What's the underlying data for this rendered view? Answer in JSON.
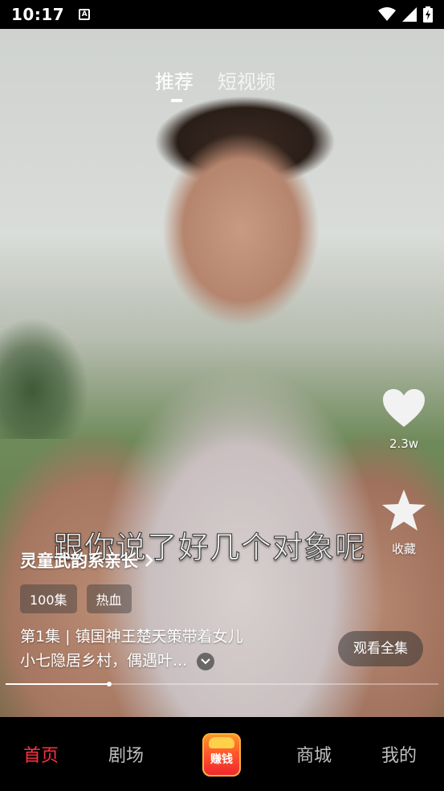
{
  "status_bar": {
    "time": "10:17",
    "icons": [
      "notification-a-icon",
      "wifi-icon",
      "signal-icon",
      "battery-charging-icon"
    ]
  },
  "top_tabs": [
    {
      "label": "推荐",
      "active": true
    },
    {
      "label": "短视频",
      "active": false
    }
  ],
  "actions": {
    "like_count": "2.3w",
    "favorite_label": "收藏"
  },
  "video": {
    "subtitle": "跟你说了好几个对象呢",
    "progress": 0.24
  },
  "drama": {
    "title": "灵童武韵系亲长",
    "tags": [
      "100集",
      "热血"
    ],
    "desc_line1": "第1集 | 镇国神王楚天策带着女儿",
    "desc_line2": "小七隐居乡村，偶遇叶...",
    "watch_all": "观看全集"
  },
  "bottom_nav": {
    "home": "首页",
    "theater": "剧场",
    "earn": "赚钱",
    "mall": "商城",
    "mine": "我的"
  },
  "colors": {
    "active_nav": "#ff3040",
    "earn_gradient_top": "#ff9a2a",
    "earn_gradient_bottom": "#f0232e"
  }
}
